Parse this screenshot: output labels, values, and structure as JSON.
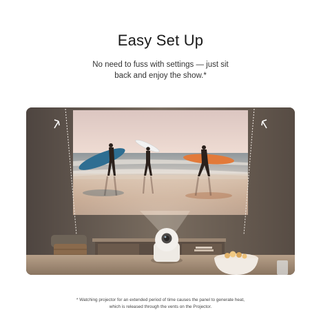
{
  "header": {
    "title": "Easy Set Up",
    "subtitle_line1": "No need to fuss with settings — just sit",
    "subtitle_line2": "back and enjoy the show.*"
  },
  "photo": {
    "subject": "projector-on-table-projecting-beach-surfers-onto-wall",
    "colors": {
      "wall": "#6f6357",
      "sky": "#e9d6cf",
      "sea": "#9fa6a9",
      "sand": "#c8a98f",
      "surfboard_blue": "#2e6e92",
      "surfboard_orange": "#e27a3a",
      "surfboard_white": "#f2f2f2"
    }
  },
  "footnote": {
    "line1": "* Watching projector for an extended period of time causes the panel to generate heat,",
    "line2": "which is released through the vents on the Projector."
  }
}
